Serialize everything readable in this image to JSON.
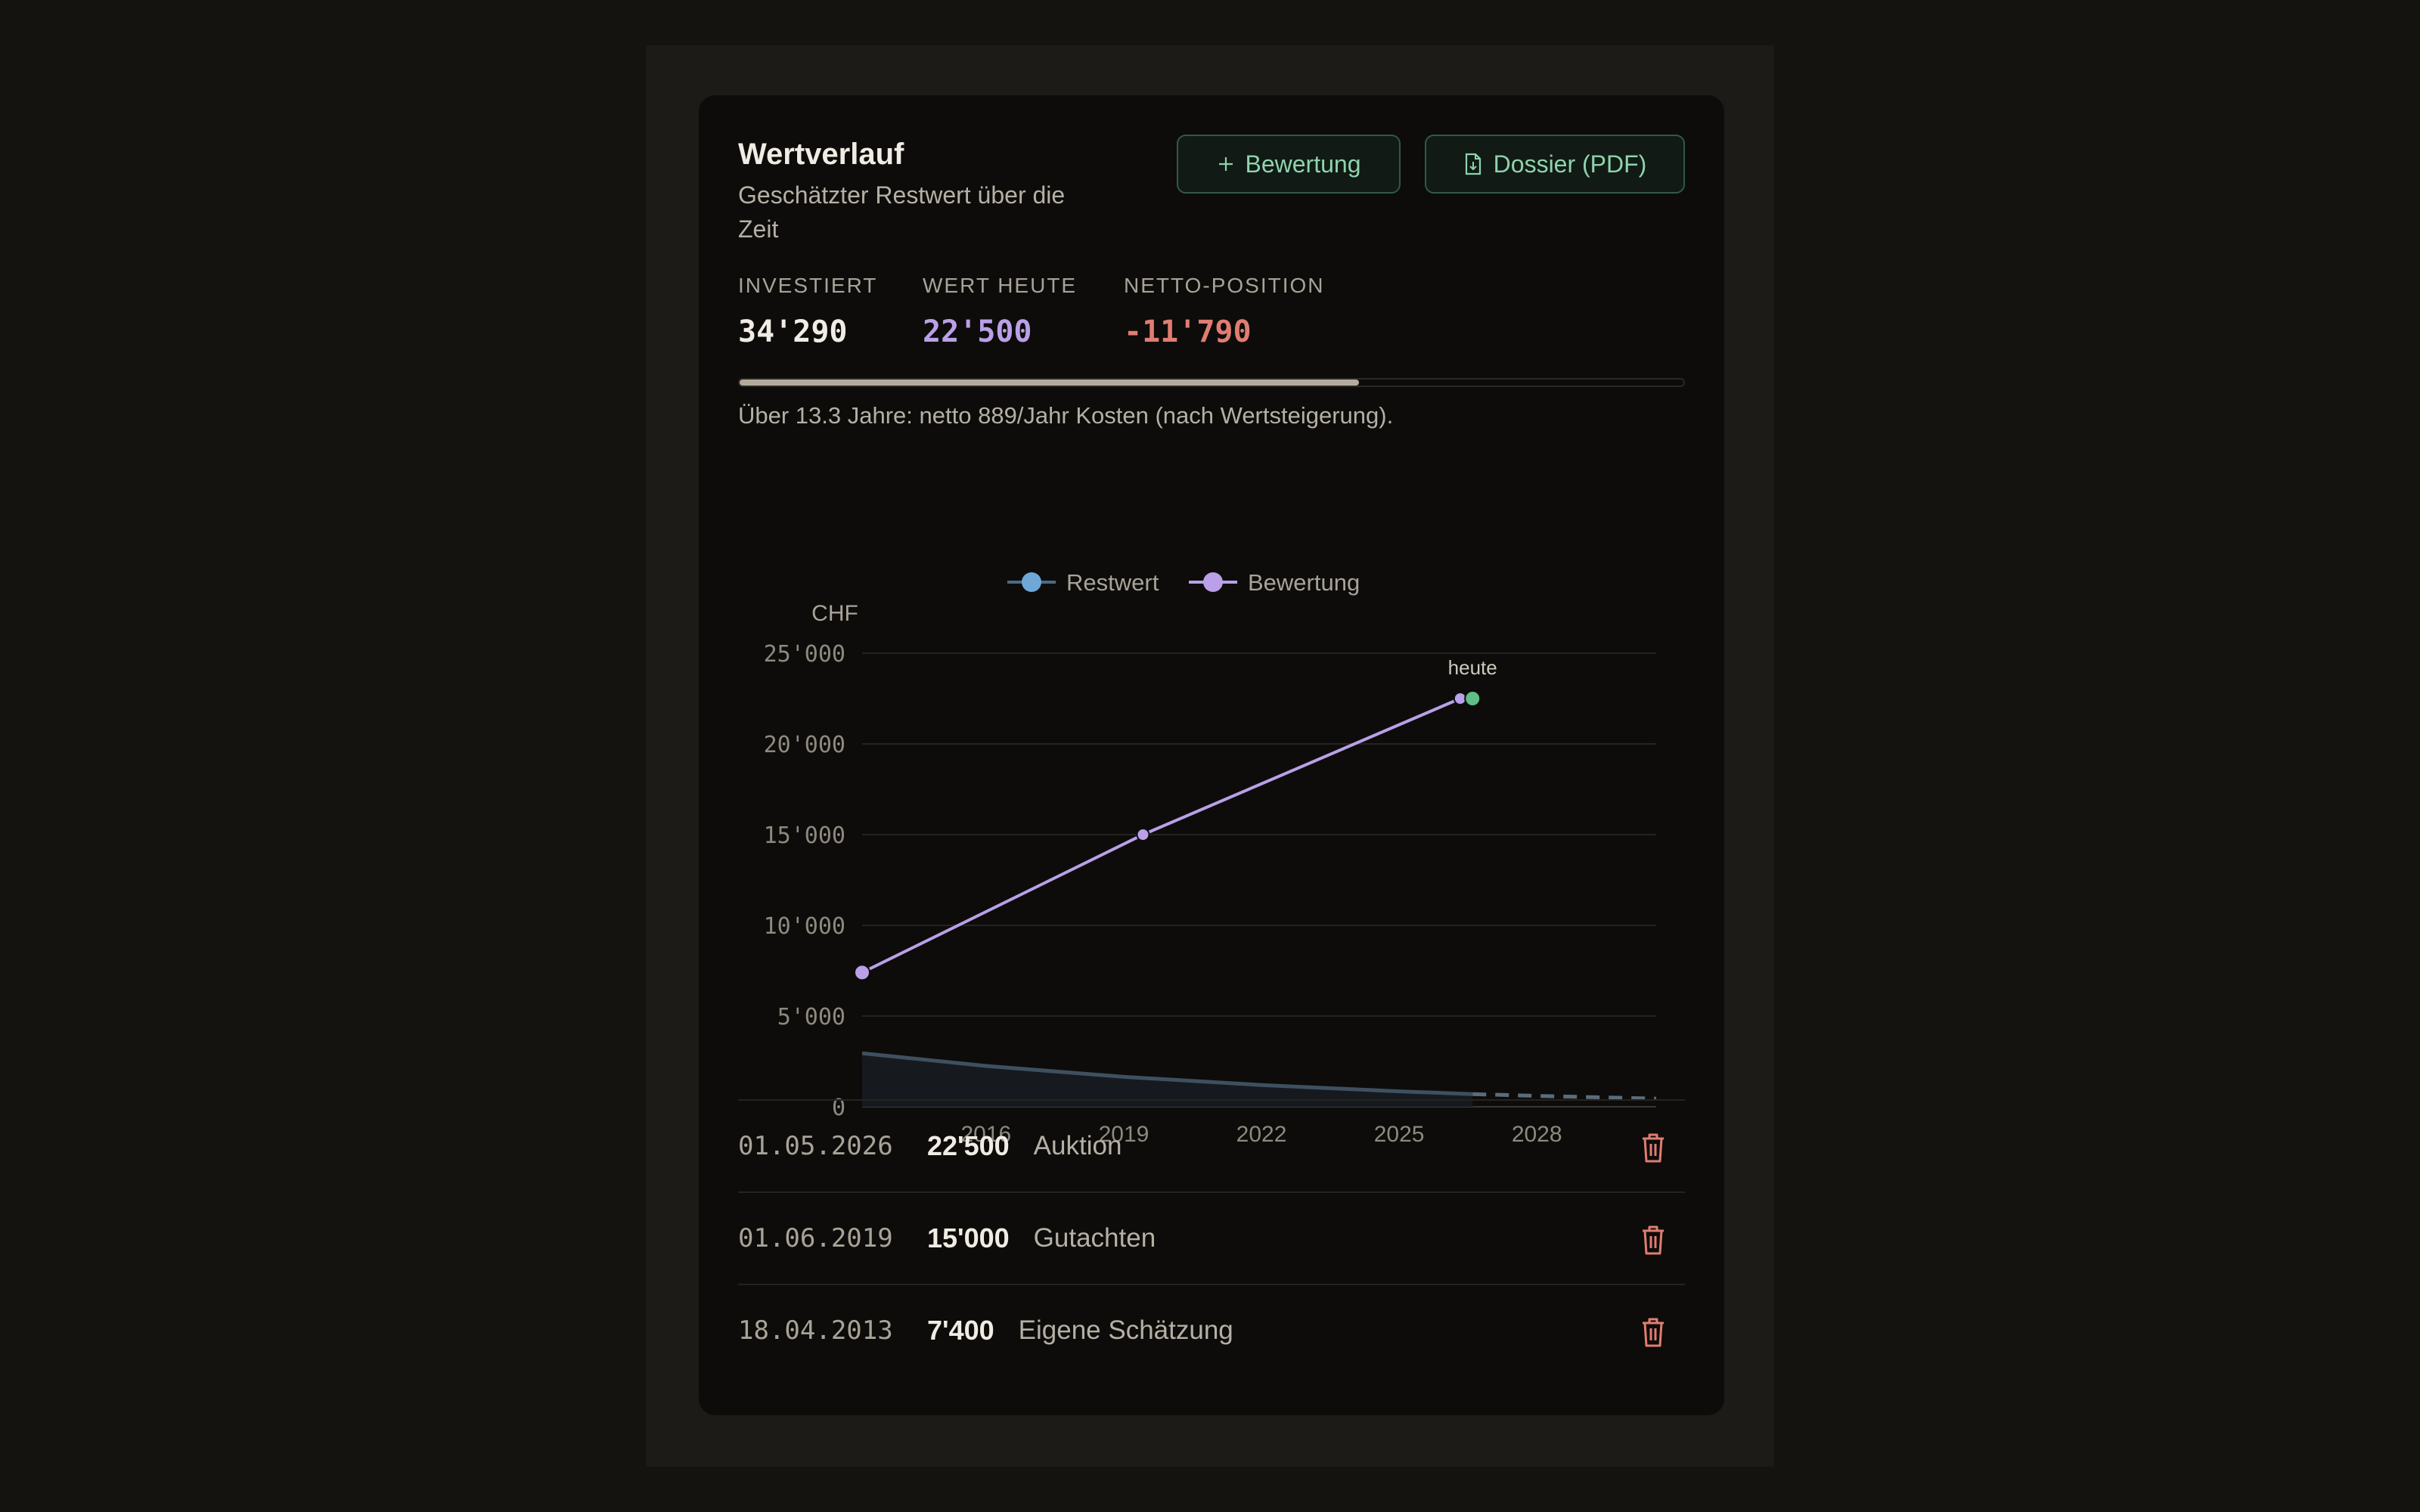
{
  "card": {
    "title": "Wertverlauf",
    "subtitle": "Geschätzter Restwert über die Zeit",
    "add_button_label": "Bewertung",
    "add_button_icon": "plus-icon",
    "pdf_button_label": "Dossier (PDF)",
    "pdf_button_icon": "file-download-icon"
  },
  "kpis": [
    {
      "label": "INVESTIERT",
      "value": "34'290",
      "color": "#f0ece4"
    },
    {
      "label": "WERT HEUTE",
      "value": "22'500",
      "color": "#b9a0e8"
    },
    {
      "label": "NETTO-POSITION",
      "value": "-11'790",
      "color": "#e07d72"
    }
  ],
  "progress": {
    "fraction": 0.656
  },
  "note": "Über 13.3 Jahre: netto 889/Jahr Kosten (nach Wertsteigerung).",
  "chart_data": {
    "type": "line",
    "ylabel": "CHF",
    "ylim": [
      0,
      25000
    ],
    "yticks": [
      "0",
      "5'000",
      "10'000",
      "15'000",
      "20'000",
      "25'000"
    ],
    "ytick_values": [
      0,
      5000,
      10000,
      15000,
      20000,
      25000
    ],
    "xlim": [
      2013.3,
      2030.6
    ],
    "xticks": [
      "2016",
      "2019",
      "2022",
      "2025",
      "2028"
    ],
    "xtick_values": [
      2016,
      2019,
      2022,
      2025,
      2028
    ],
    "legend": [
      "Restwert",
      "Bewertung"
    ],
    "legend_position": "top-center",
    "series": [
      {
        "name": "Restwert",
        "color": "#6ea8d8",
        "line_color": "#3e5060",
        "x": [
          2013.3,
          2016,
          2019,
          2022,
          2025,
          2026.6
        ],
        "y": [
          2950,
          2250,
          1650,
          1200,
          850,
          700
        ],
        "projection_x": [
          2026.6,
          2028,
          2030.6
        ],
        "projection_y": [
          700,
          600,
          450
        ]
      },
      {
        "name": "Bewertung",
        "color": "#b9a0e8",
        "x": [
          2013.3,
          2019.42,
          2026.33
        ],
        "y": [
          7400,
          15000,
          22500
        ]
      }
    ],
    "annotation": {
      "text": "heute",
      "x": 2026.6,
      "y": 22500,
      "marker_color": "#5fbf84"
    }
  },
  "entries": [
    {
      "date": "01.05.2026",
      "value": "22'500",
      "label": "Auktion"
    },
    {
      "date": "01.06.2019",
      "value": "15'000",
      "label": "Gutachten"
    },
    {
      "date": "18.04.2013",
      "value": "7'400",
      "label": "Eigene Schätzung"
    }
  ],
  "icons": {
    "delete": "trash-icon"
  },
  "colors": {
    "accent": "#8fd3ac",
    "danger": "#e07d72",
    "purple": "#b9a0e8"
  }
}
